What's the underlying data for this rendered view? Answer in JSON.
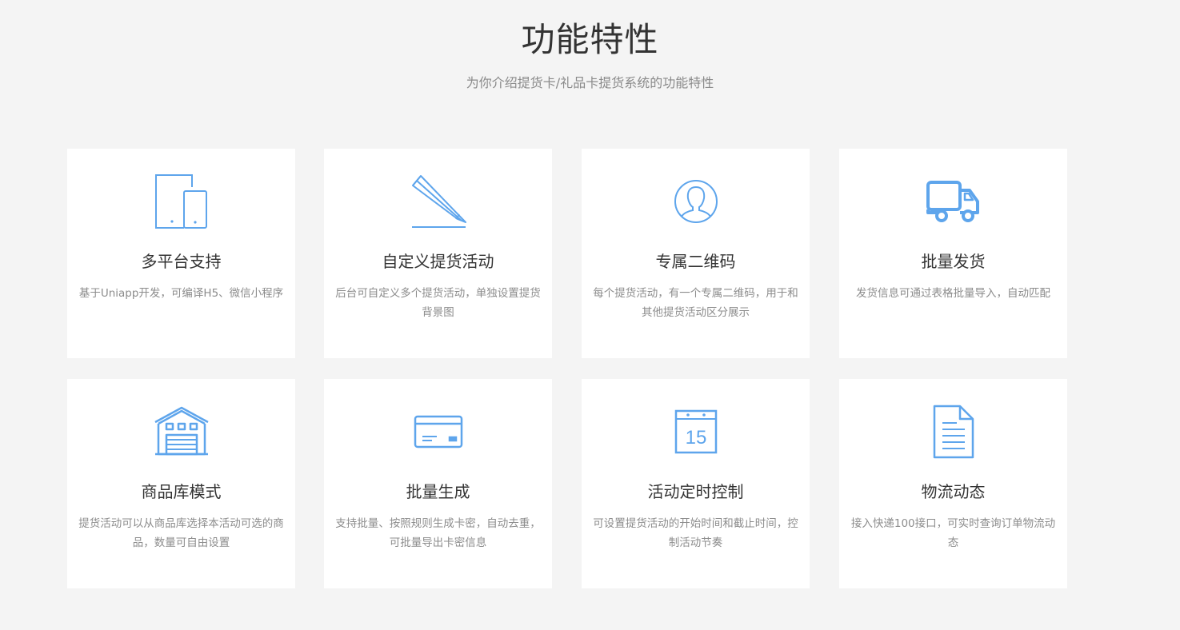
{
  "header": {
    "title": "功能特性",
    "subtitle": "为你介绍提货卡/礼品卡提货系统的功能特性"
  },
  "colors": {
    "icon": "#5ea5ec",
    "background": "#f4f4f4",
    "card": "#ffffff",
    "title": "#333333",
    "desc": "#8c8c8c"
  },
  "features": [
    {
      "icon": "devices-icon",
      "title": "多平台支持",
      "desc": "基于Uniapp开发，可编译H5、微信小程序"
    },
    {
      "icon": "pencil-icon",
      "title": "自定义提货活动",
      "desc": "后台可自定义多个提货活动，单独设置提货背景图"
    },
    {
      "icon": "user-avatar-icon",
      "title": "专属二维码",
      "desc": "每个提货活动，有一个专属二维码，用于和其他提货活动区分展示"
    },
    {
      "icon": "delivery-truck-icon",
      "title": "批量发货",
      "desc": "发货信息可通过表格批量导入，自动匹配"
    },
    {
      "icon": "warehouse-icon",
      "title": "商品库模式",
      "desc": "提货活动可以从商品库选择本活动可选的商品，数量可自由设置"
    },
    {
      "icon": "credit-card-icon",
      "title": "批量生成",
      "desc": "支持批量、按照规则生成卡密，自动去重，可批量导出卡密信息"
    },
    {
      "icon": "calendar-icon",
      "calendar_day": "15",
      "title": "活动定时控制",
      "desc": "可设置提货活动的开始时间和截止时间，控制活动节奏"
    },
    {
      "icon": "document-icon",
      "title": "物流动态",
      "desc": "接入快递100接口，可实时查询订单物流动态"
    }
  ]
}
